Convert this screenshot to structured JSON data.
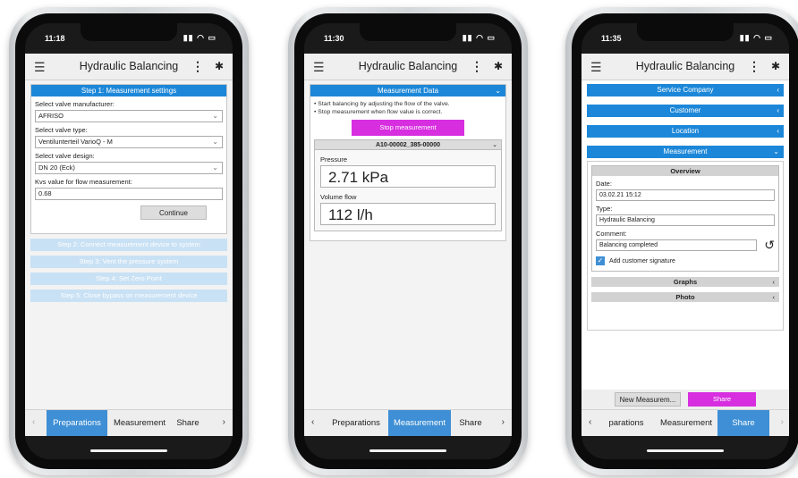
{
  "app": {
    "title": "Hydraulic Balancing"
  },
  "phones": [
    {
      "time": "11:18"
    },
    {
      "time": "11:30"
    },
    {
      "time": "11:35"
    }
  ],
  "screen1": {
    "header": "Step 1: Measurement settings",
    "manufacturer_label": "Select valve manufacturer:",
    "manufacturer_value": "AFRISO",
    "type_label": "Select valve type:",
    "type_value": "Ventilunterteil VarioQ - M",
    "design_label": "Select valve design:",
    "design_value": "DN 20 (Eck)",
    "kvs_label": "Kvs value for flow measurement:",
    "kvs_value": "0.68",
    "continue_label": "Continue",
    "steps": [
      "Step 2: Connect measurement device to system",
      "Step 3: Vent the pressure system",
      "Step 4: Set Zero Point",
      "Step 5: Close bypass on measurement device"
    ],
    "tabs": [
      "Preparations",
      "Measurement",
      "Share"
    ]
  },
  "screen2": {
    "header": "Measurement Data",
    "bullets": [
      "Start balancing by adjusting the flow of the valve.",
      "Stop measurement when flow value is correct."
    ],
    "stop_label": "Stop measurement",
    "sensor_id": "A10-00002_385-00000",
    "pressure_label": "Pressure",
    "pressure_value": "2.71 kPa",
    "flow_label": "Volume flow",
    "flow_value": "112 l/h",
    "tabs": [
      "Preparations",
      "Measurement",
      "Share"
    ]
  },
  "screen3": {
    "sections": [
      "Service Company",
      "Customer",
      "Location",
      "Measurement"
    ],
    "overview_label": "Overview",
    "date_label": "Date:",
    "date_value": "03.02.21 15:12",
    "type_label": "Type:",
    "type_value": "Hydraulic Balancing",
    "comment_label": "Comment:",
    "comment_value": "Balancing completed",
    "signature_label": "Add customer signature",
    "signature_checked": true,
    "graphs_label": "Graphs",
    "photo_label": "Photo",
    "new_measurement_label": "New Measurem...",
    "share_button_label": "Share",
    "tabs": [
      "parations",
      "Measurement",
      "Share"
    ]
  },
  "colors": {
    "accent_blue": "#1c87d8",
    "magenta": "#d72ee0",
    "tab_active": "#3e8fd5"
  }
}
